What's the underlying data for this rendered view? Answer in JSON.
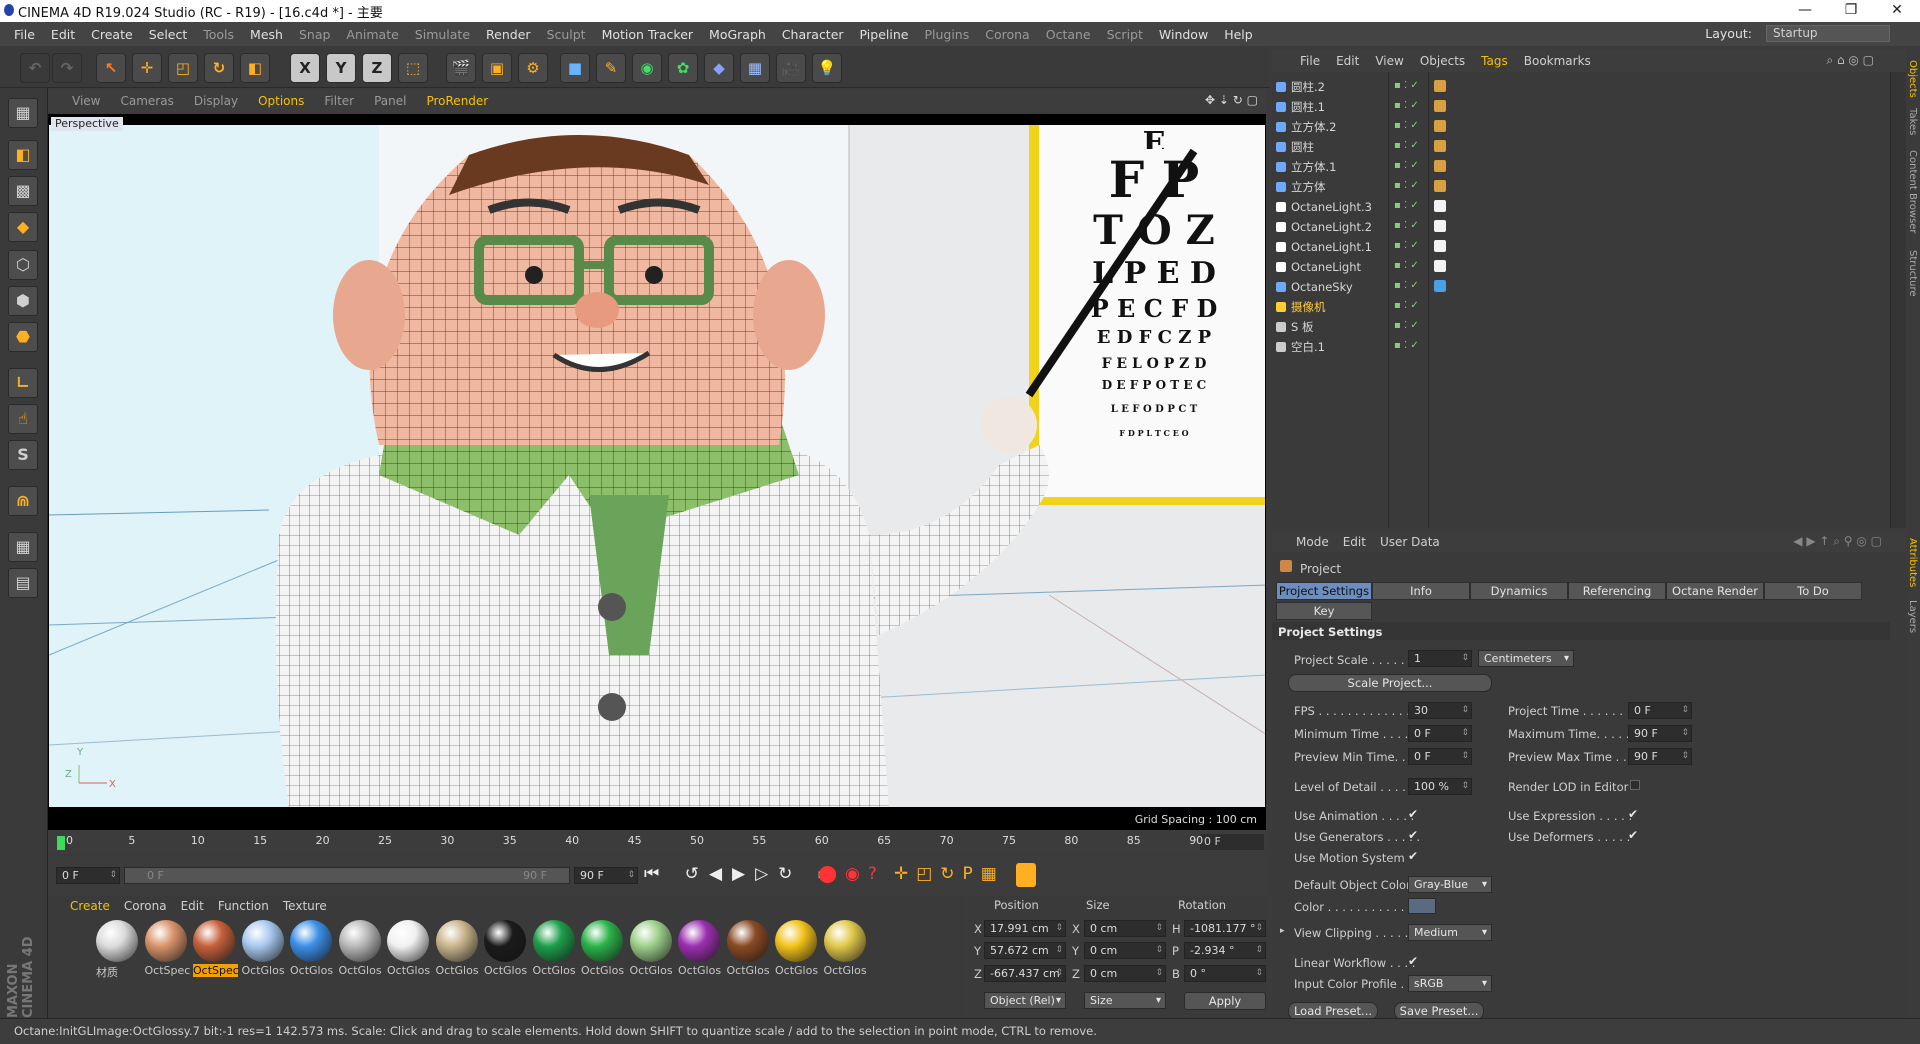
{
  "app": {
    "title": "CINEMA 4D R19.024 Studio (RC - R19) - [16.c4d *] - 主要"
  },
  "menu": [
    "File",
    "Edit",
    "Create",
    "Select",
    "Tools",
    "Mesh",
    "Snap",
    "Animate",
    "Simulate",
    "Render",
    "Sculpt",
    "Motion Tracker",
    "MoGraph",
    "Character",
    "Pipeline",
    "Plugins",
    "Corona",
    "Octane",
    "Script",
    "Window",
    "Help"
  ],
  "layout": {
    "label": "Layout:",
    "value": "Startup"
  },
  "viewport_menu": [
    "View",
    "Cameras",
    "Display",
    "Options",
    "Filter",
    "Panel",
    "ProRender"
  ],
  "viewport": {
    "label": "Perspective",
    "grid_spacing": "Grid Spacing : 100 cm",
    "axis_y": "Y",
    "axis_z": "Z",
    "axis_x": "X"
  },
  "eye_chart": [
    "E",
    "F P",
    "T O Z",
    "L P E D",
    "P E C F D",
    "E D F C Z P",
    "F E L O P Z D",
    "D E F P O T E C",
    "L E F O D P C T",
    "F D P L T C E O"
  ],
  "object_manager": {
    "menu": [
      "File",
      "Edit",
      "View",
      "Objects",
      "Tags",
      "Bookmarks"
    ],
    "objects": [
      {
        "name": "圆柱.2",
        "color": "#6fa8ff"
      },
      {
        "name": "圆柱.1",
        "color": "#6fa8ff"
      },
      {
        "name": "立方体.2",
        "color": "#6fa8ff"
      },
      {
        "name": "圆柱",
        "color": "#6fa8ff"
      },
      {
        "name": "立方体.1",
        "color": "#6fa8ff"
      },
      {
        "name": "立方体",
        "color": "#6fa8ff"
      },
      {
        "name": "OctaneLight.3",
        "color": "#ffffff"
      },
      {
        "name": "OctaneLight.2",
        "color": "#ffffff"
      },
      {
        "name": "OctaneLight.1",
        "color": "#ffffff"
      },
      {
        "name": "OctaneLight",
        "color": "#ffffff"
      },
      {
        "name": "OctaneSky",
        "color": "#6fa8ff"
      },
      {
        "name": "摄像机",
        "color": "#ffcc33"
      },
      {
        "name": "S 板",
        "color": "#cccccc"
      },
      {
        "name": "空白.1",
        "color": "#cccccc"
      }
    ]
  },
  "side_tabs_top": [
    "Objects",
    "Takes",
    "Content Browser",
    "Structure"
  ],
  "side_tabs_bottom": [
    "Attributes",
    "Layers"
  ],
  "attributes": {
    "menu": [
      "Mode",
      "Edit",
      "User Data"
    ],
    "object_label": "Project",
    "tabs": [
      "Project Settings",
      "Info",
      "Dynamics",
      "Referencing",
      "Octane Render",
      "To Do"
    ],
    "tab2": "Key Interpolation",
    "section": "Project Settings",
    "project_scale_label": "Project Scale . . . . . .",
    "project_scale_value": "1",
    "project_scale_unit": "Centimeters",
    "scale_project_btn": "Scale Project...",
    "fps_label": "FPS . . . . . . . . . . . . . . .",
    "fps_value": "30",
    "project_time_label": "Project Time . . . . . .",
    "project_time_value": "0 F",
    "min_time_label": "Minimum Time . . . . .",
    "min_time_value": "0 F",
    "max_time_label": "Maximum Time. . . . .",
    "max_time_value": "90 F",
    "prev_min_label": "Preview Min Time. . .",
    "prev_min_value": "0 F",
    "prev_max_label": "Preview Max Time . . .",
    "prev_max_value": "90 F",
    "lod_label": "Level of Detail . . . . .",
    "lod_value": "100 %",
    "render_lod_label": "Render LOD in Editor",
    "use_anim_label": "Use Animation . . . . .",
    "use_expr_label": "Use Expression . . . . .",
    "use_gen_label": "Use Generators . . . . .",
    "use_def_label": "Use Deformers . . . . .",
    "use_motion_label": "Use Motion System",
    "def_color_label": "Default Object Color",
    "def_color_value": "Gray-Blue",
    "color_label": "Color . . . . . . . . . . .",
    "view_clip_label": "View Clipping . . . . .",
    "view_clip_value": "Medium",
    "linear_label": "Linear Workflow . . . .",
    "input_profile_label": "Input Color Profile . .",
    "input_profile_value": "sRGB",
    "load_preset": "Load Preset...",
    "save_preset": "Save Preset..."
  },
  "timeline": {
    "ticks": [
      "0",
      "5",
      "10",
      "15",
      "20",
      "25",
      "30",
      "35",
      "40",
      "45",
      "50",
      "55",
      "60",
      "65",
      "70",
      "75",
      "80",
      "85",
      "90"
    ],
    "end_frame": "0 F"
  },
  "time_controls": {
    "start": "0 F",
    "scrub_start": "0 F",
    "scrub_end": "90 F",
    "end": "90 F"
  },
  "materials": {
    "menu": [
      "Create",
      "Corona",
      "Edit",
      "Function",
      "Texture"
    ],
    "items": [
      {
        "name": "材质",
        "color": "#dcdcdc"
      },
      {
        "name": "OctSpec",
        "color": "#d9936a"
      },
      {
        "name": "OctSpec",
        "color": "#c6603a"
      },
      {
        "name": "OctGlos",
        "color": "#a8c8f0"
      },
      {
        "name": "OctGlos",
        "color": "#3b8fe8"
      },
      {
        "name": "OctGlos",
        "color": "#b9b9b9"
      },
      {
        "name": "OctGlos",
        "color": "#f1f1f1"
      },
      {
        "name": "OctGlos",
        "color": "#c9b48c"
      },
      {
        "name": "OctGlos",
        "color": "#1b1b1b"
      },
      {
        "name": "OctGlos",
        "color": "#1e9e4a"
      },
      {
        "name": "OctGlos",
        "color": "#2bb34a"
      },
      {
        "name": "OctGlos",
        "color": "#9ed08a"
      },
      {
        "name": "OctGlos",
        "color": "#9b2fb0"
      },
      {
        "name": "OctGlos",
        "color": "#8a4a25"
      },
      {
        "name": "OctGlos",
        "color": "#f2c21a"
      },
      {
        "name": "OctGlos",
        "color": "#e0c84a"
      }
    ]
  },
  "coordinates": {
    "headers": [
      "Position",
      "Size",
      "Rotation"
    ],
    "px_label": "X",
    "px": "17.991 cm",
    "sx_label": "X",
    "sx": "0 cm",
    "rh_label": "H",
    "rh": "-1081.177 °",
    "py_label": "Y",
    "py": "57.672 cm",
    "sy_label": "Y",
    "sy": "0 cm",
    "rp_label": "P",
    "rp": "-2.934 °",
    "pz_label": "Z",
    "pz": "-667.437 cm",
    "sz_label": "Z",
    "sz": "0 cm",
    "rb_label": "B",
    "rb": "0 °",
    "mode": "Object (Rel)",
    "size_mode": "Size",
    "apply": "Apply"
  },
  "status": "Octane:InitGLImage:OctGlossy.7  bit:-1 res=1  142.573 ms.     Scale: Click and drag to scale elements. Hold down SHIFT to quantize scale / add to the selection in point mode, CTRL to remove.",
  "brand": "MAXON CINEMA 4D"
}
